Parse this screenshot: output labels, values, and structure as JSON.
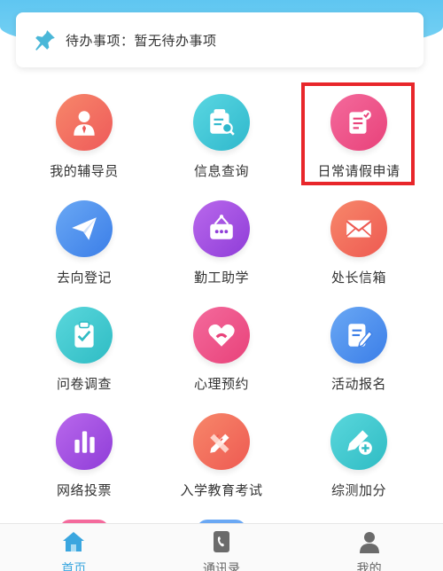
{
  "todo": {
    "text": "待办事项：暂无待办事项"
  },
  "grid": [
    {
      "label": "我的辅导员",
      "icon": "counselor-icon",
      "color": "#f06a5a"
    },
    {
      "label": "信息查询",
      "icon": "info-search-icon",
      "color": "#38c6d6"
    },
    {
      "label": "日常请假申请",
      "icon": "leave-request-icon",
      "color": "#f0508a"
    },
    {
      "label": "去向登记",
      "icon": "paper-plane-icon",
      "color": "#3d8ef0"
    },
    {
      "label": "勤工助学",
      "icon": "work-study-icon",
      "color": "#a148e0"
    },
    {
      "label": "处长信箱",
      "icon": "mail-icon",
      "color": "#f07058"
    },
    {
      "label": "问卷调查",
      "icon": "questionnaire-icon",
      "color": "#36c8cc"
    },
    {
      "label": "心理预约",
      "icon": "heart-phone-icon",
      "color": "#f0508a"
    },
    {
      "label": "活动报名",
      "icon": "signup-icon",
      "color": "#3d8ef0"
    },
    {
      "label": "网络投票",
      "icon": "bar-chart-icon",
      "color": "#a148e0"
    },
    {
      "label": "入学教育考试",
      "icon": "pencil-ruler-icon",
      "color": "#f07058"
    },
    {
      "label": "综测加分",
      "icon": "pen-plus-icon",
      "color": "#36c8cc"
    }
  ],
  "nav": [
    {
      "label": "首页",
      "icon": "home-icon",
      "active": true
    },
    {
      "label": "通讯录",
      "icon": "contacts-icon",
      "active": false
    },
    {
      "label": "我的",
      "icon": "profile-icon",
      "active": false
    }
  ],
  "colors": {
    "accent": "#3aa6df",
    "highlight": "#e8262a"
  }
}
